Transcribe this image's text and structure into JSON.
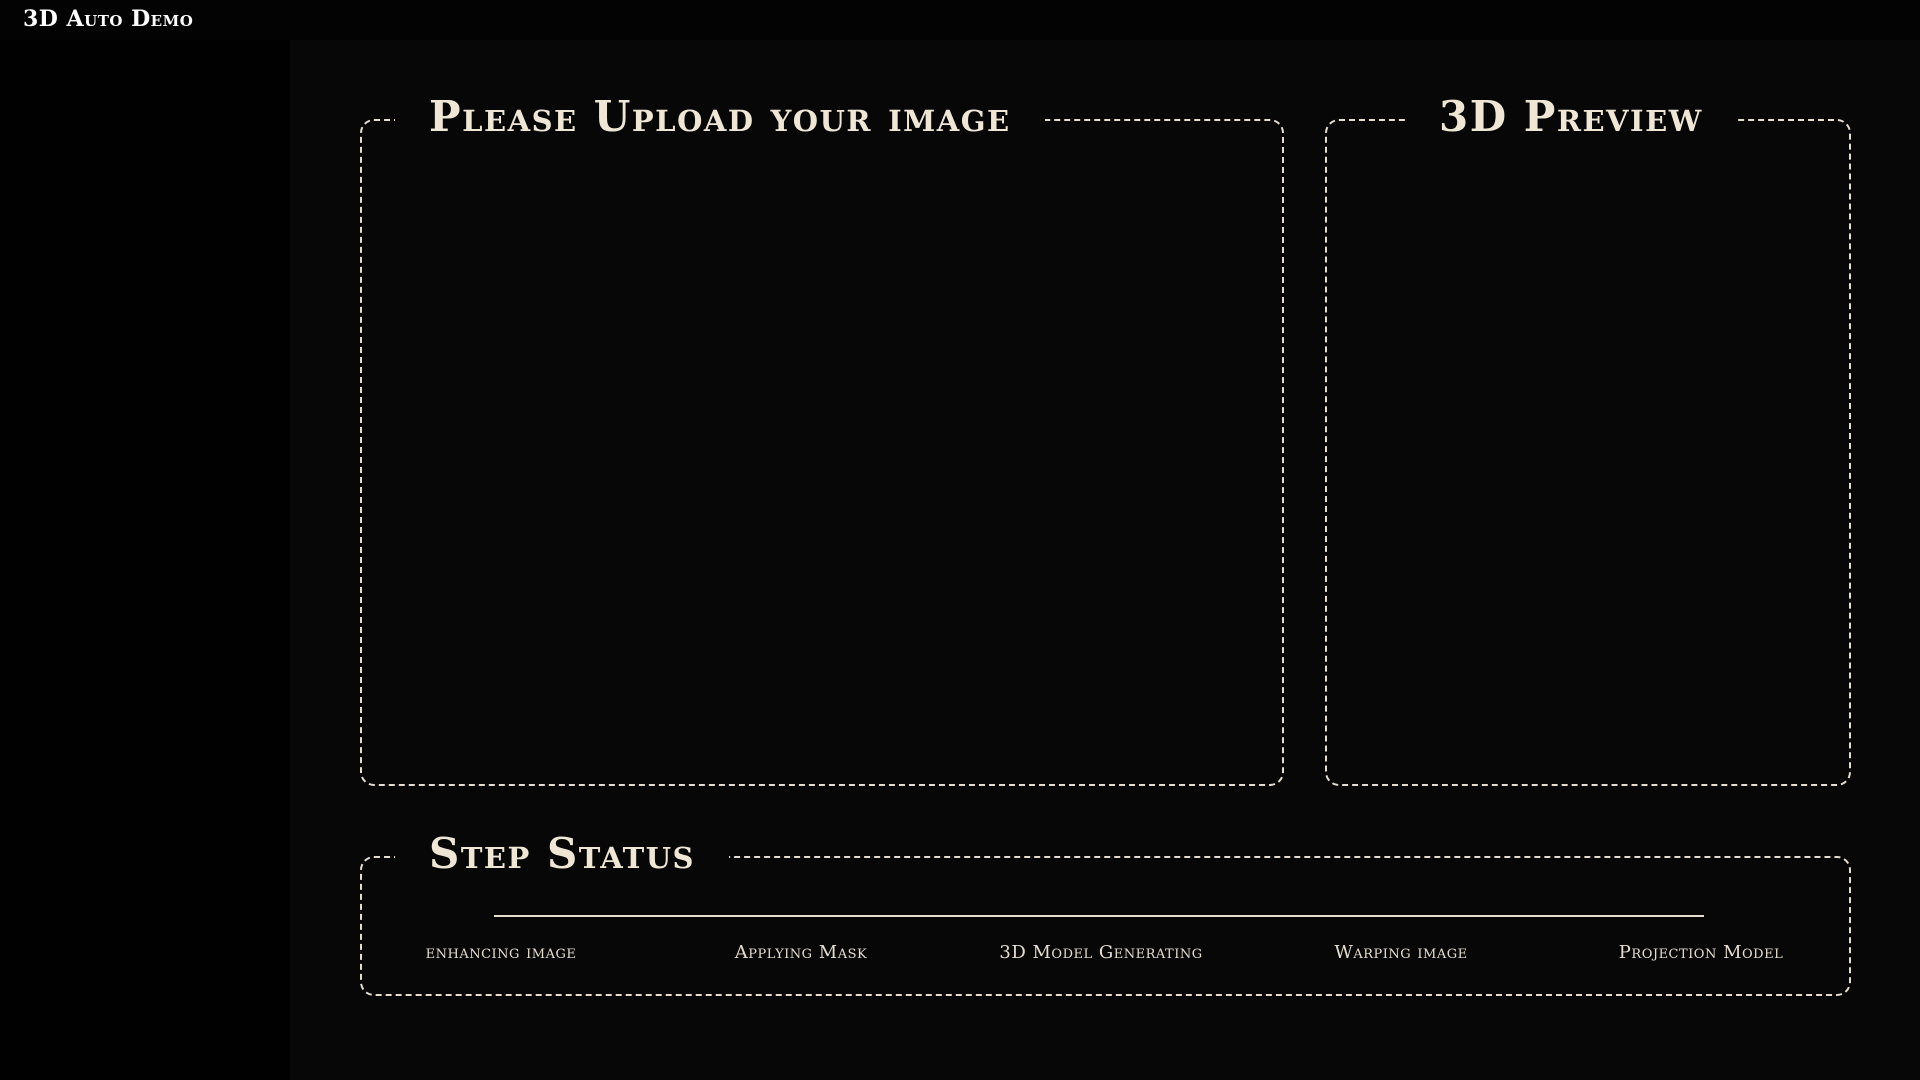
{
  "app": {
    "title": "3D Auto Demo"
  },
  "upload": {
    "title": "Please Upload your image"
  },
  "preview": {
    "title": "3D Preview"
  },
  "status": {
    "title": "Step Status",
    "steps": [
      {
        "label": "enhancing image"
      },
      {
        "label": "Applying Mask"
      },
      {
        "label": "3D Model Generating"
      },
      {
        "label": "Warping image"
      },
      {
        "label": "Projection Model"
      }
    ]
  },
  "colors": {
    "background": "#070707",
    "sidebar": "#010101",
    "accent": "#e6ddcf"
  }
}
